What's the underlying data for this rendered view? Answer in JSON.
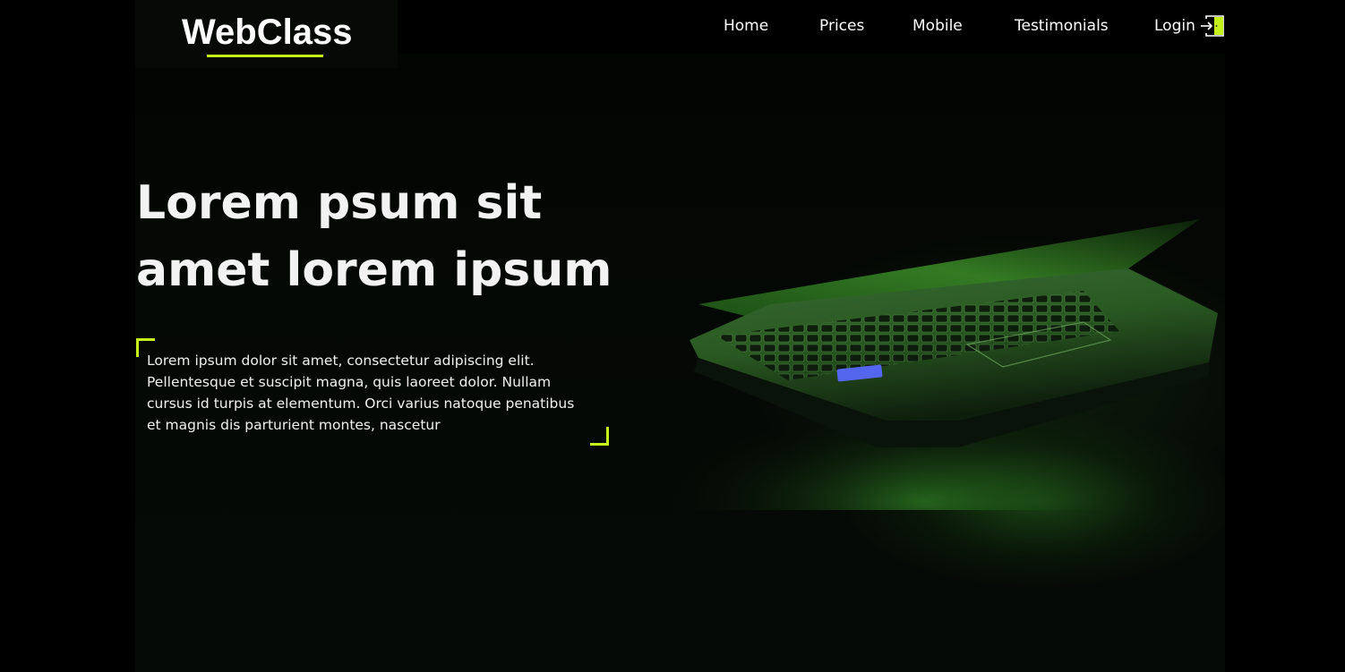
{
  "brand": {
    "logo_text": "WebClass",
    "accent_color": "#c6f01a"
  },
  "nav": {
    "items": [
      {
        "label": "Home"
      },
      {
        "label": "Prices"
      },
      {
        "label": "Mobile"
      },
      {
        "label": "Testimonials"
      },
      {
        "label": "Login",
        "icon": "login-door-icon"
      }
    ]
  },
  "hero": {
    "headline_line1": "Lorem psum sit",
    "headline_line2": "amet lorem ipsum",
    "paragraph_lines": [
      "Lorem ipsum dolor sit amet, consectetur adipiscing elit.",
      "Pellentesque et suscipit magna, quis laoreet dolor. Nullam",
      "cursus id turpis at elementum. Orci varius natoque penatibus",
      "et magnis dis parturient montes, nascetur"
    ],
    "image": "laptop-green-glow-image"
  },
  "colors": {
    "background": "#000000",
    "text": "#ffffff"
  }
}
